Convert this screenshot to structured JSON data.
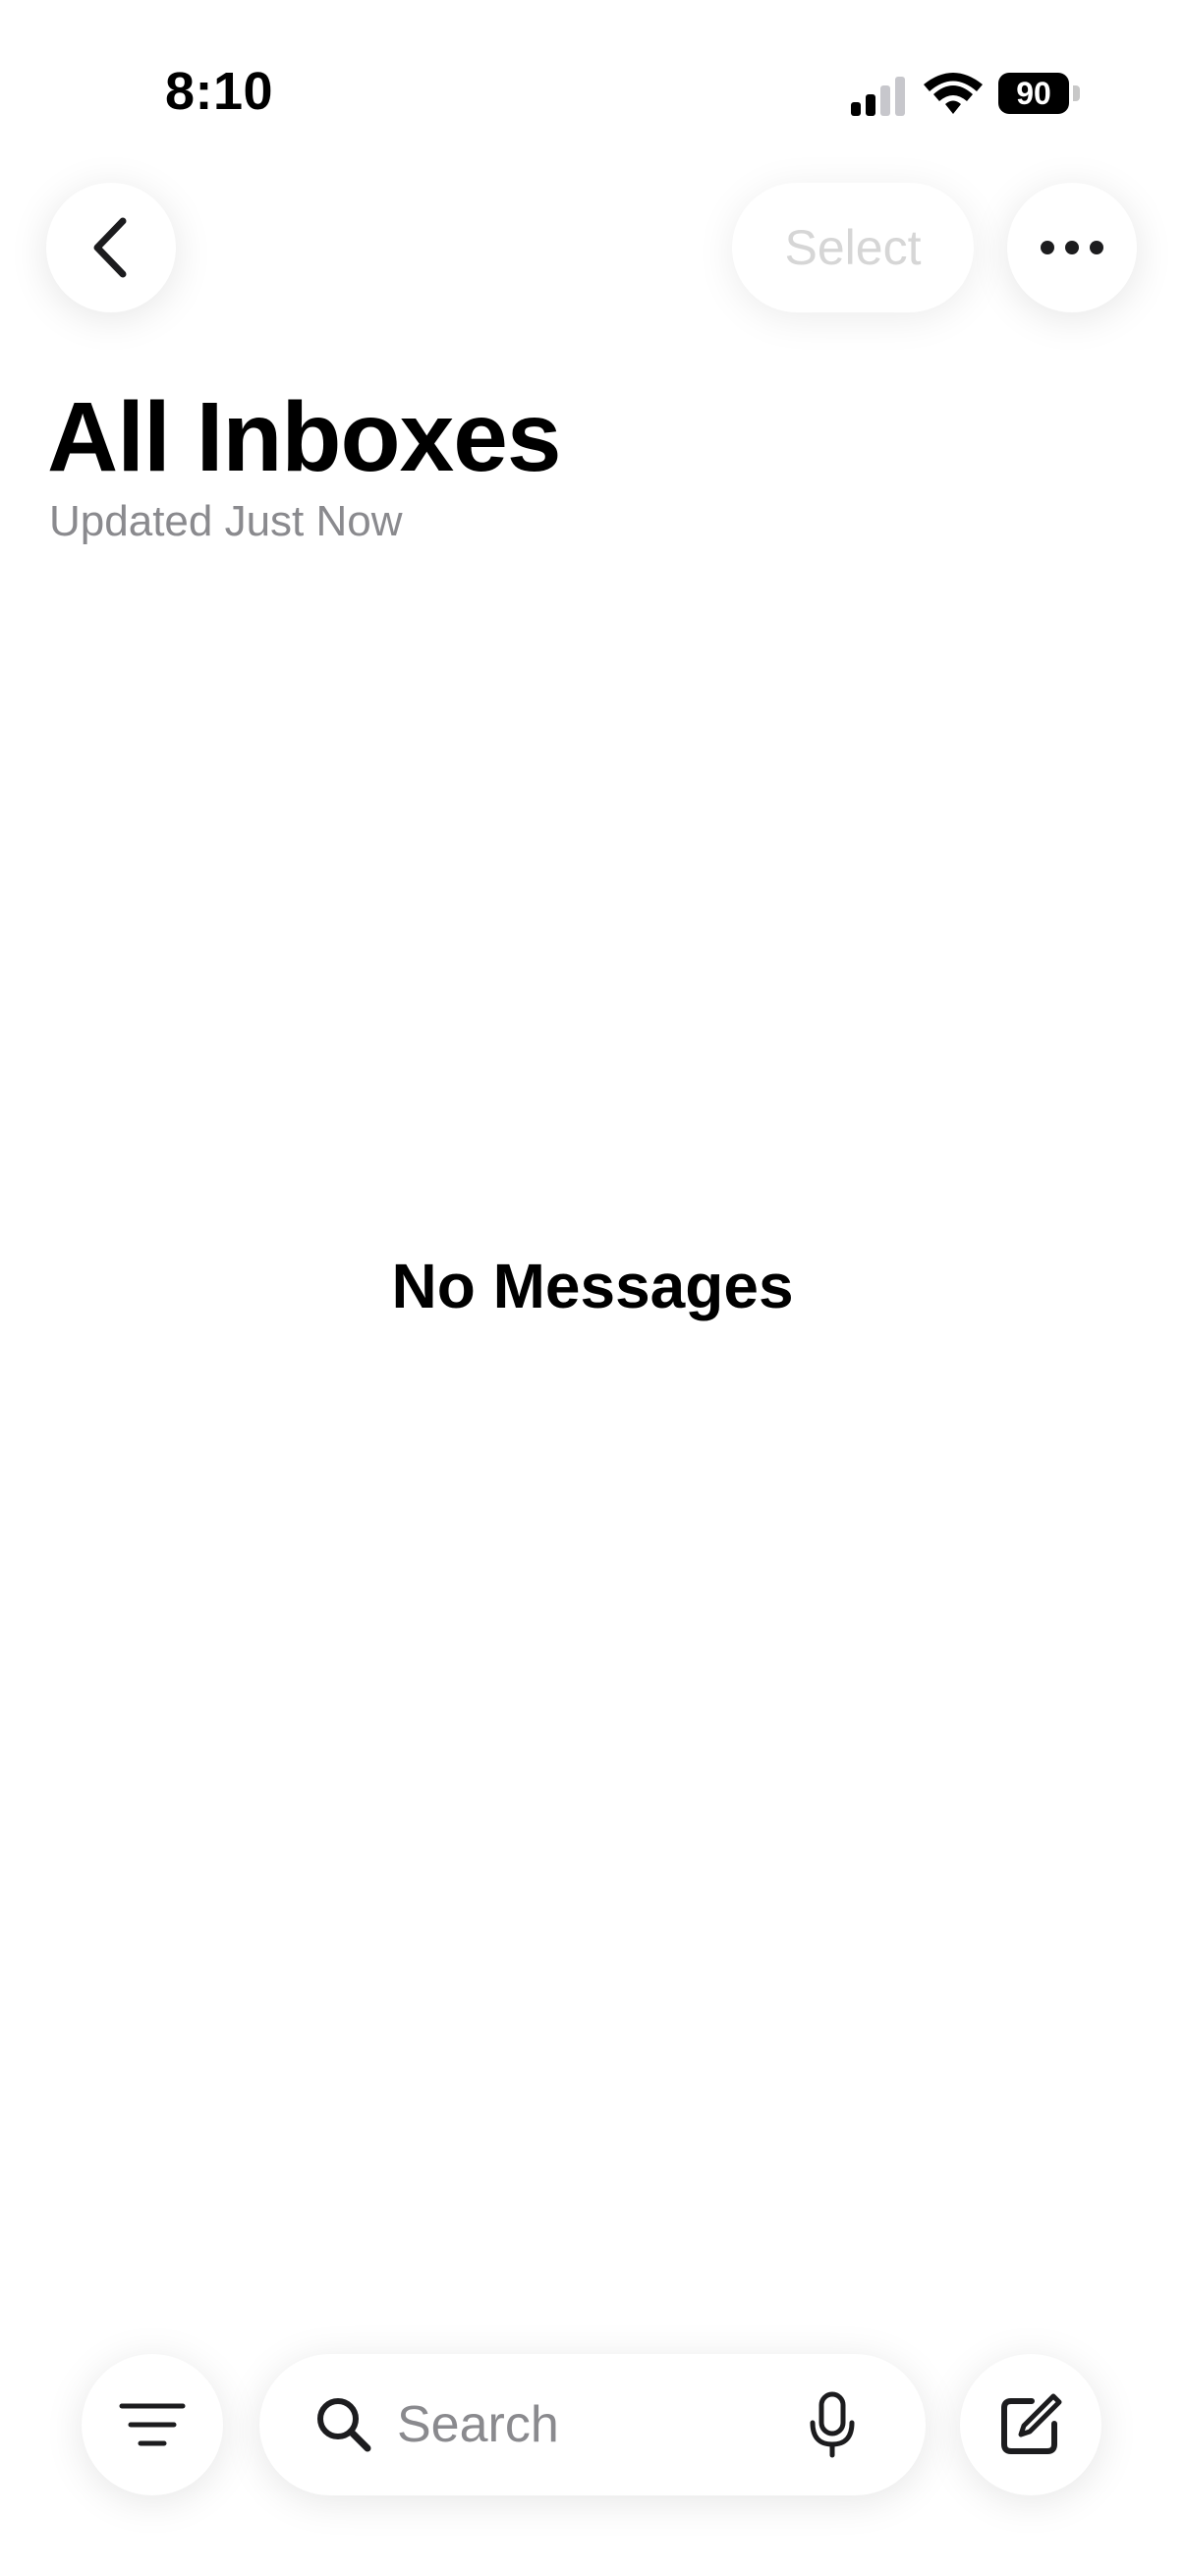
{
  "status_bar": {
    "time": "8:10",
    "battery_level": "90"
  },
  "toolbar": {
    "back_icon": "chevron-left-icon",
    "select_label": "Select",
    "more_icon": "ellipsis-icon"
  },
  "header": {
    "title": "All Inboxes",
    "subtitle": "Updated Just Now"
  },
  "main": {
    "empty_message": "No Messages"
  },
  "bottom_bar": {
    "filter_icon": "filter-icon",
    "search_placeholder": "Search",
    "mic_icon": "microphone-icon",
    "compose_icon": "compose-icon"
  },
  "colors": {
    "text_primary": "#000000",
    "text_secondary": "#8a8a8e",
    "disabled": "#d6d6d6",
    "background": "#ffffff"
  }
}
